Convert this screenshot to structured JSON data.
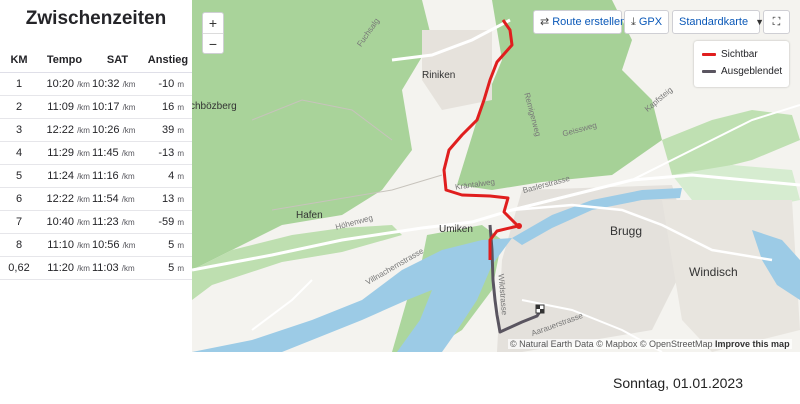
{
  "splits": {
    "title": "Zwischenzeiten",
    "headers": {
      "km": "KM",
      "pace": "Tempo",
      "gap": "SAT",
      "elev": "Anstieg"
    },
    "pace_unit": "/km",
    "elev_unit": "m",
    "rows": [
      {
        "km": "1",
        "pace": "10:20",
        "gap": "10:32",
        "elev": "-10"
      },
      {
        "km": "2",
        "pace": "11:09",
        "gap": "10:17",
        "elev": "16"
      },
      {
        "km": "3",
        "pace": "12:22",
        "gap": "10:26",
        "elev": "39"
      },
      {
        "km": "4",
        "pace": "11:29",
        "gap": "11:45",
        "elev": "-13"
      },
      {
        "km": "5",
        "pace": "11:24",
        "gap": "11:16",
        "elev": "4"
      },
      {
        "km": "6",
        "pace": "12:22",
        "gap": "11:54",
        "elev": "13"
      },
      {
        "km": "7",
        "pace": "10:40",
        "gap": "11:23",
        "elev": "-59"
      },
      {
        "km": "8",
        "pace": "11:10",
        "gap": "10:56",
        "elev": "5"
      },
      {
        "km": "0,62",
        "pace": "11:20",
        "gap": "11:03",
        "elev": "5"
      }
    ]
  },
  "map": {
    "zoom_in": "+",
    "zoom_out": "−",
    "toolbar": {
      "route_label": "Route erstellen",
      "gpx_label": "GPX",
      "style_label": "Standardkarte",
      "fullscreen_glyph": "⛶"
    },
    "legend": {
      "visible_label": "Sichtbar",
      "hidden_label": "Ausgeblendet",
      "visible_color": "#e01e1e",
      "hidden_color": "#5a5560"
    },
    "places": {
      "riniken": "Riniken",
      "hafen": "Hafen",
      "umiken": "Umiken",
      "brugg": "Brugg",
      "windisch": "Windisch",
      "bozberg": "chbözberg"
    },
    "streets": {
      "fuchsalg": "Fuchsalg",
      "remigerweg": "Remigerweg",
      "geissweg": "Geissweg",
      "kapfsteig": "Kapfsteig",
      "kraentalweg": "Kräntalweg",
      "baslerstrasse": "Baslerstrasse",
      "hoehenweg": "Höhenweg",
      "villnachernstrasse": "Villnachernstrasse",
      "wildstrasse": "Wildstrasse",
      "aarauerstrasse": "Aarauerstrasse"
    },
    "attribution": {
      "natural_earth": "© Natural Earth Data",
      "mapbox": "© Mapbox",
      "osm": "© OpenStreetMap",
      "improve": "Improve this map"
    }
  },
  "footer": {
    "date": "Sonntag, 01.01.2023"
  }
}
